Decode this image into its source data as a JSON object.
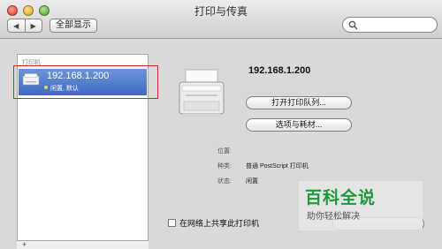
{
  "window": {
    "title": "打印与传真"
  },
  "toolbar": {
    "back_glyph": "◀",
    "forward_glyph": "▶",
    "show_all_label": "全部显示"
  },
  "search": {
    "icon": "search-icon"
  },
  "sidebar": {
    "header": "打印机",
    "printers": [
      {
        "name": "192.168.1.200",
        "status": "闲置, 默认"
      }
    ],
    "add_glyph": "+"
  },
  "detail": {
    "printer_name": "192.168.1.200",
    "open_queue_label": "打开打印队列...",
    "options_label": "选项与耗材...",
    "info": [
      {
        "label": "位置:",
        "value": ""
      },
      {
        "label": "种类:",
        "value": "普通 PostScript 打印机"
      },
      {
        "label": "状态:",
        "value": "闲置"
      }
    ],
    "share_label": "在网络上共享此打印机"
  },
  "watermark": {
    "title": "百科全说",
    "subtitle": "助你轻松解决"
  },
  "colors": {
    "selection": "#4a78c8",
    "highlight_border": "#dd2222",
    "watermark_green": "#1a9a3a"
  }
}
